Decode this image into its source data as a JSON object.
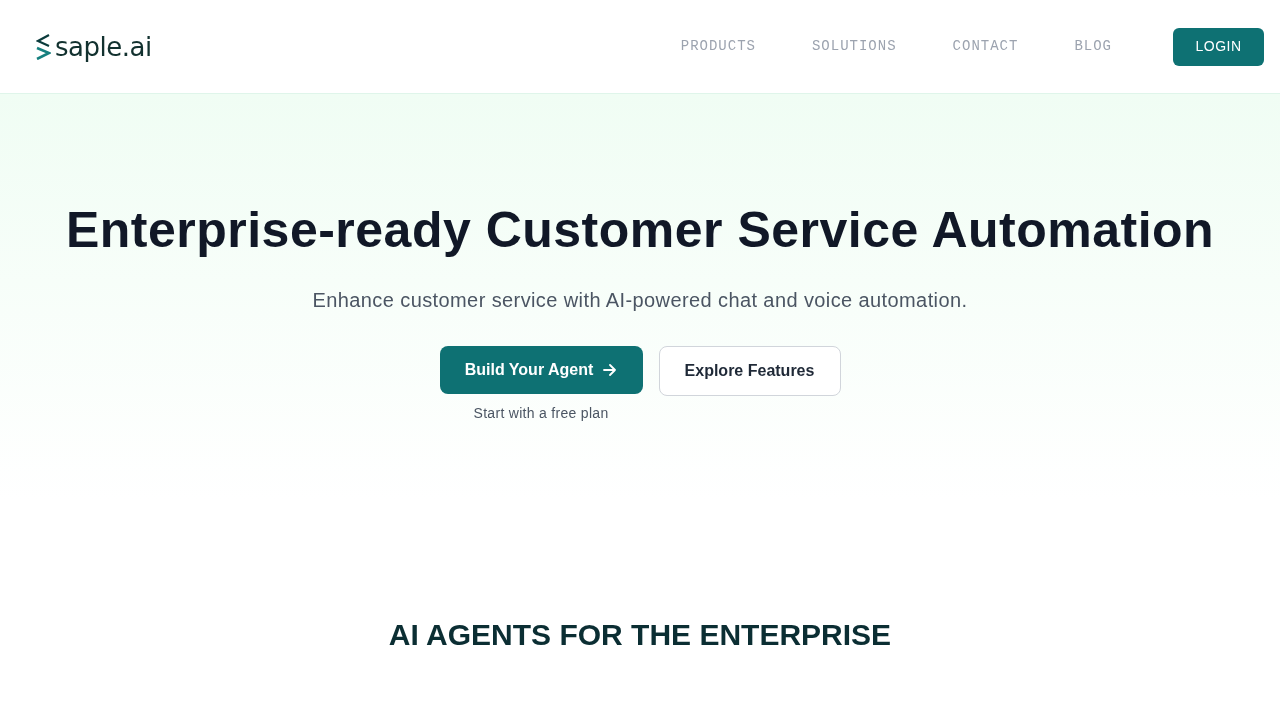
{
  "header": {
    "logo": "saple.ai",
    "nav": [
      {
        "label": "PRODUCTS"
      },
      {
        "label": "SOLUTIONS"
      },
      {
        "label": "CONTACT"
      },
      {
        "label": "BLOG"
      }
    ],
    "login": "LOGIN"
  },
  "hero": {
    "title": "Enterprise-ready Customer Service Automation",
    "subtitle": "Enhance customer service with AI-powered chat and voice automation.",
    "primary_button": "Build Your Agent",
    "primary_note": "Start with a free plan",
    "secondary_button": "Explore Features"
  },
  "section": {
    "title": "AI AGENTS FOR THE ENTERPRISE"
  }
}
